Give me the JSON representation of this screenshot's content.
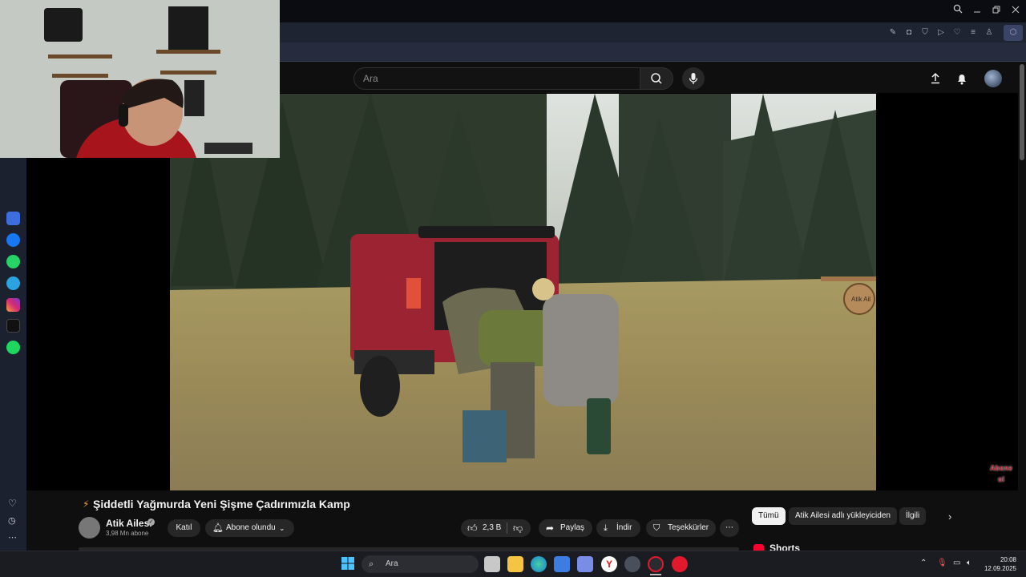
{
  "colors": {
    "background": "#0f0f0f",
    "chrome_dark": "#0b0b12",
    "chrome_toolbar": "#1f2433",
    "taskbar": "#1b1c21",
    "accent_red": "#ff0033",
    "chip_active_bg": "#f1f1f1"
  },
  "youtube": {
    "search_placeholder": "Ara",
    "header_icons": [
      "upload-icon",
      "bell-icon",
      "avatar"
    ]
  },
  "video": {
    "title_icon": "lightning-icon",
    "title": "Şiddetli Yağmurda Yeni Şişme Çadırımızla Kamp",
    "watermark": "Abone ol",
    "sign_text": "Atik Ail"
  },
  "channel": {
    "name": "Atik Ailesi",
    "subscribers": "3,98 Mn abone",
    "join_label": "Katıl",
    "subscribed_label": "Abone olundu"
  },
  "actions": {
    "likes": "2,3 B",
    "share_label": "Paylaş",
    "download_label": "İndir",
    "thanks_label": "Teşekkürler"
  },
  "chips": {
    "all": "Tümü",
    "uploader": "Atik Ailesi adlı yükleyiciden",
    "related": "İlgili"
  },
  "recommendations": {
    "shorts_heading": "Shorts"
  },
  "taskbar": {
    "search_placeholder": "Ara",
    "time": "20:08",
    "date": "12.09.2025"
  }
}
